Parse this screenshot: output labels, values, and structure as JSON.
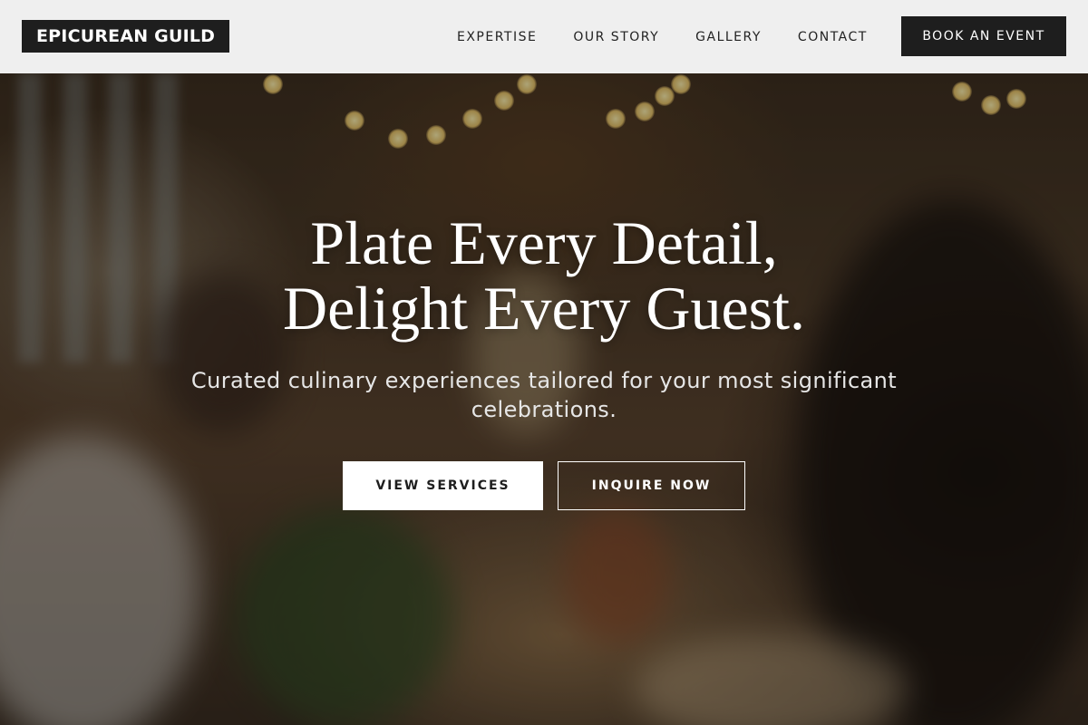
{
  "header": {
    "logo_text": "EPICUREAN GUILD",
    "nav": [
      {
        "label": "EXPERTISE"
      },
      {
        "label": "OUR STORY"
      },
      {
        "label": "GALLERY"
      },
      {
        "label": "CONTACT"
      }
    ],
    "cta_label": "BOOK AN EVENT"
  },
  "hero": {
    "title_line1": "Plate Every Detail,",
    "title_line2": "Delight Every Guest.",
    "subtitle": "Curated culinary experiences tailored for your most significant celebrations.",
    "primary_button": "VIEW SERVICES",
    "secondary_button": "INQUIRE NOW"
  },
  "colors": {
    "header_bg": "#efefef",
    "dark": "#1e1e1e",
    "white": "#ffffff"
  }
}
